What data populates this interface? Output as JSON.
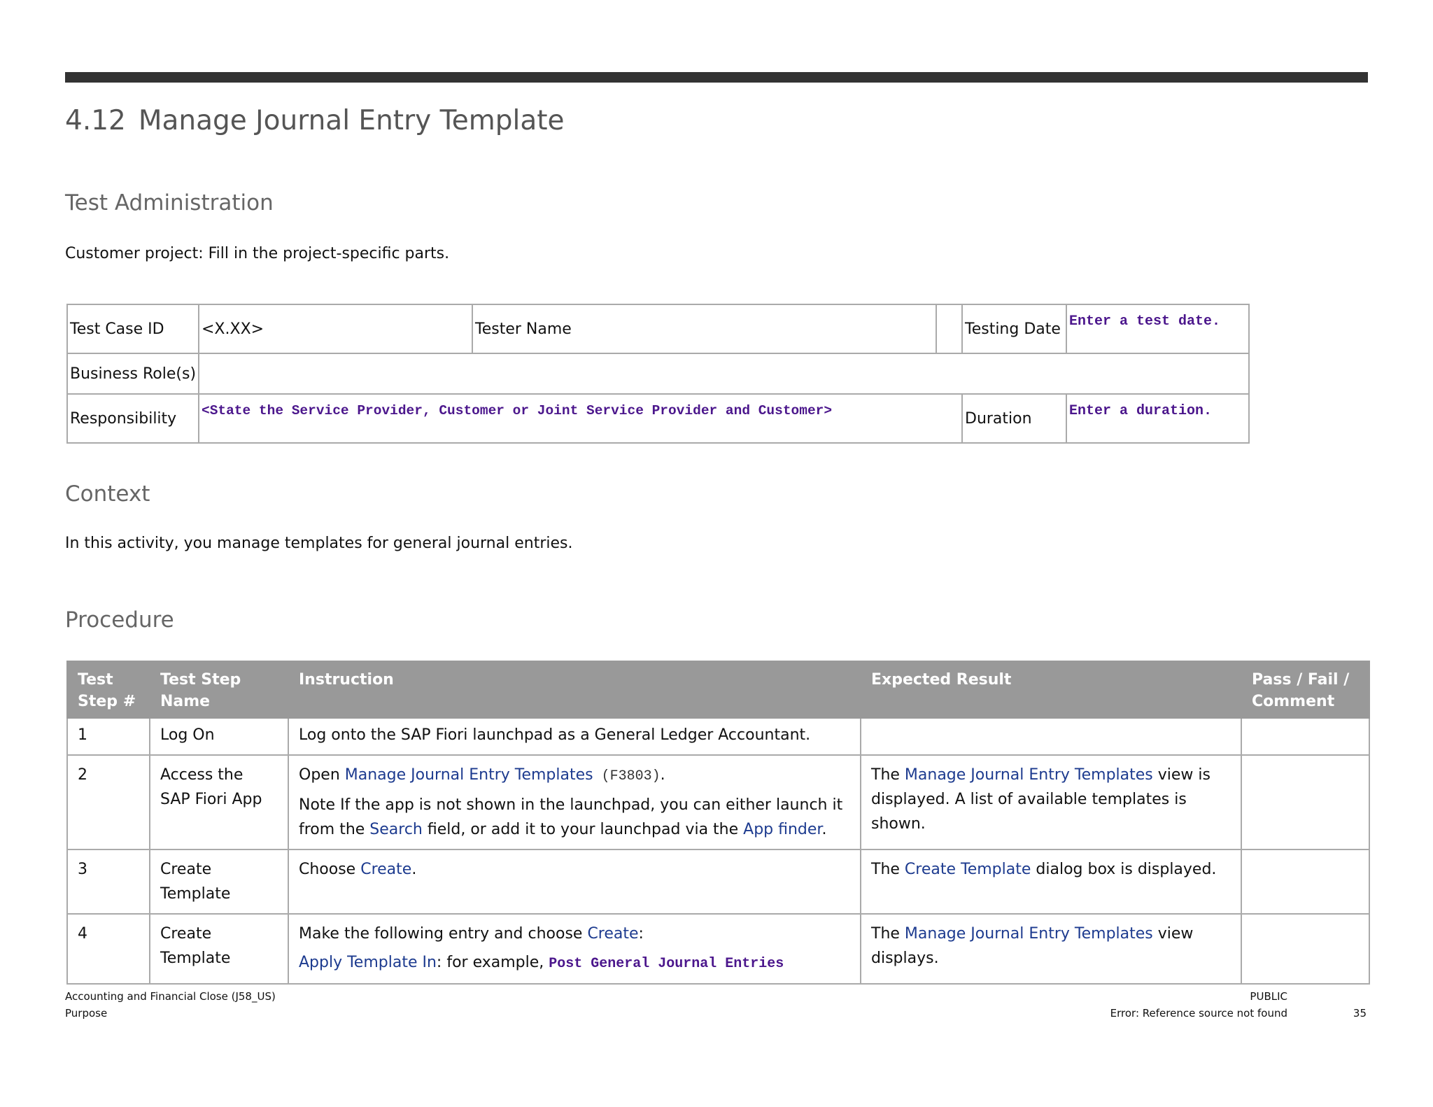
{
  "section": {
    "number": "4.12",
    "title": "Manage Journal Entry Template"
  },
  "test_admin": {
    "heading": "Test Administration",
    "intro": "Customer project: Fill in the project-specific parts.",
    "table": {
      "test_case_id_label": "Test Case ID",
      "test_case_id_value": "<X.XX>",
      "tester_name_label": "Tester Name",
      "testing_date_label": "Testing Date",
      "testing_date_value": "Enter a test date.",
      "business_roles_label": "Business Role(s)",
      "responsibility_label": "Responsibility",
      "responsibility_value": "<State the Service Provider, Customer or Joint Service Provider and Customer>",
      "duration_label": "Duration",
      "duration_value": "Enter a duration."
    }
  },
  "context": {
    "heading": "Context",
    "text": "In this activity, you manage templates for general journal entries."
  },
  "procedure": {
    "heading": "Procedure",
    "columns": [
      "Test Step #",
      "Test Step Name",
      "Instruction",
      "Expected Result",
      "Pass / Fail / Comment"
    ],
    "rows": [
      {
        "step": "1",
        "name": "Log On",
        "instruction": {
          "text": "Log onto the SAP Fiori launchpad as a General Ledger Accountant."
        },
        "expected": {}
      },
      {
        "step": "2",
        "name": "Access the SAP Fiori App",
        "instruction": {
          "pre": "Open ",
          "link": "Manage Journal Entry Templates",
          "code": " (F3803)",
          "post": ".",
          "note_pre": "Note If the app is not shown in the launchpad, you can either launch it from the ",
          "note_link1": "Search",
          "note_mid": " field, or add it to your launchpad via the ",
          "note_link2": "App finder",
          "note_post": "."
        },
        "expected": {
          "pre": "The ",
          "link": "Manage Journal Entry Templates",
          "post": " view is displayed. A list of available templates is shown."
        }
      },
      {
        "step": "3",
        "name": "Create Template",
        "instruction": {
          "pre": "Choose ",
          "link": "Create",
          "post": "."
        },
        "expected": {
          "pre": "The ",
          "link": "Create Template",
          "post": " dialog box is displayed."
        }
      },
      {
        "step": "4",
        "name": "Create Template",
        "instruction": {
          "pre": "Make the following entry and choose ",
          "link": "Create",
          "post": ":",
          "field": "Apply Template In",
          "field_mid": ": for example, ",
          "value": "Post General Journal Entries"
        },
        "expected": {
          "pre": "The ",
          "link": "Manage Journal Entry Templates",
          "post": " view displays."
        }
      }
    ]
  },
  "footer": {
    "left1": "Accounting and Financial Close (J58_US)",
    "left2": "Purpose",
    "right1": "PUBLIC",
    "right2": "Error: Reference source not found",
    "page": "35"
  },
  "colors": {
    "link": "#1d3b8f",
    "placeholder": "#4b168c",
    "header_bg": "#999999",
    "top_bar": "#333333"
  }
}
